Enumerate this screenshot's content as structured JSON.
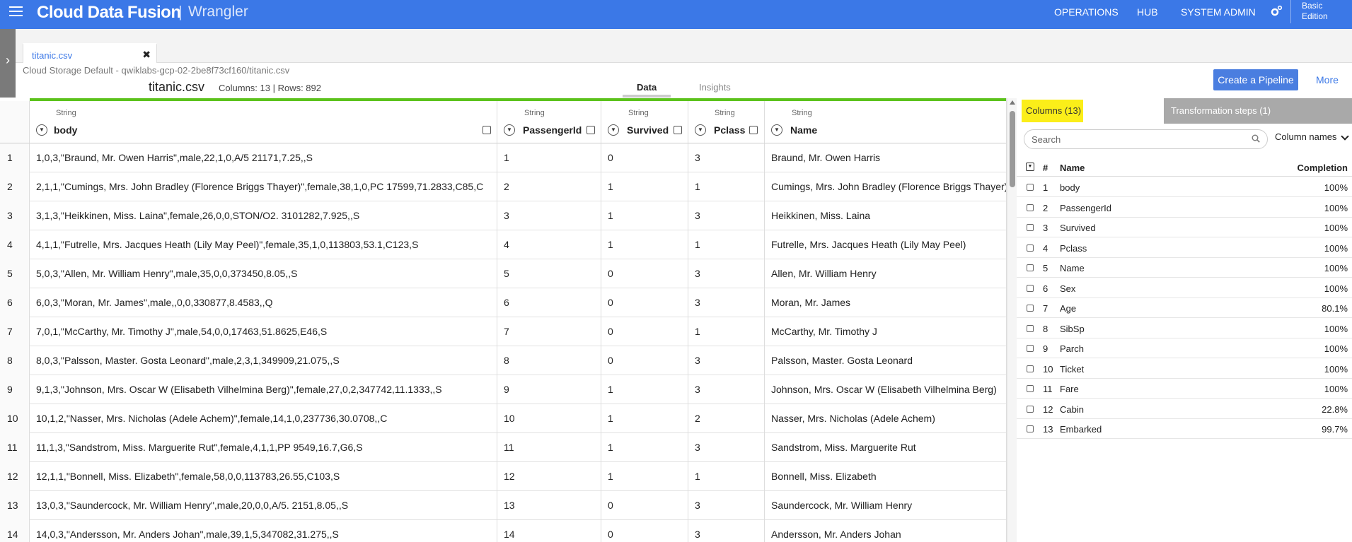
{
  "app": {
    "brand": "Cloud Data Fusion",
    "separator": "|",
    "product": "Wrangler",
    "nav": [
      "OPERATIONS",
      "HUB",
      "SYSTEM ADMIN"
    ],
    "edition_line1": "Basic",
    "edition_line2": "Edition"
  },
  "file_tab": {
    "label": "titanic.csv",
    "close": "✖"
  },
  "dataset": {
    "path": "Cloud Storage Default - qwiklabs-gcp-02-2be8f73cf160/titanic.csv",
    "name": "titanic.csv",
    "info": "Columns: 13 | Rows: 892",
    "tabs": [
      "Data",
      "Insights"
    ],
    "create_pipeline": "Create a Pipeline",
    "more": "More"
  },
  "grid": {
    "columns": [
      {
        "type": "String",
        "name": "body"
      },
      {
        "type": "String",
        "name": "PassengerId"
      },
      {
        "type": "String",
        "name": "Survived"
      },
      {
        "type": "String",
        "name": "Pclass"
      },
      {
        "type": "String",
        "name": "Name"
      }
    ],
    "rows": [
      [
        "1",
        "1,0,3,\"Braund, Mr. Owen Harris\",male,22,1,0,A/5 21171,7.25,,S",
        "1",
        "0",
        "3",
        "Braund, Mr. Owen Harris"
      ],
      [
        "2",
        "2,1,1,\"Cumings, Mrs. John Bradley (Florence Briggs Thayer)\",female,38,1,0,PC 17599,71.2833,C85,C",
        "2",
        "1",
        "1",
        "Cumings, Mrs. John Bradley (Florence Briggs Thayer)"
      ],
      [
        "3",
        "3,1,3,\"Heikkinen, Miss. Laina\",female,26,0,0,STON/O2. 3101282,7.925,,S",
        "3",
        "1",
        "3",
        "Heikkinen, Miss. Laina"
      ],
      [
        "4",
        "4,1,1,\"Futrelle, Mrs. Jacques Heath (Lily May Peel)\",female,35,1,0,113803,53.1,C123,S",
        "4",
        "1",
        "1",
        "Futrelle, Mrs. Jacques Heath (Lily May Peel)"
      ],
      [
        "5",
        "5,0,3,\"Allen, Mr. William Henry\",male,35,0,0,373450,8.05,,S",
        "5",
        "0",
        "3",
        "Allen, Mr. William Henry"
      ],
      [
        "6",
        "6,0,3,\"Moran, Mr. James\",male,,0,0,330877,8.4583,,Q",
        "6",
        "0",
        "3",
        "Moran, Mr. James"
      ],
      [
        "7",
        "7,0,1,\"McCarthy, Mr. Timothy J\",male,54,0,0,17463,51.8625,E46,S",
        "7",
        "0",
        "1",
        "McCarthy, Mr. Timothy J"
      ],
      [
        "8",
        "8,0,3,\"Palsson, Master. Gosta Leonard\",male,2,3,1,349909,21.075,,S",
        "8",
        "0",
        "3",
        "Palsson, Master. Gosta Leonard"
      ],
      [
        "9",
        "9,1,3,\"Johnson, Mrs. Oscar W (Elisabeth Vilhelmina Berg)\",female,27,0,2,347742,11.1333,,S",
        "9",
        "1",
        "3",
        "Johnson, Mrs. Oscar W (Elisabeth Vilhelmina Berg)"
      ],
      [
        "10",
        "10,1,2,\"Nasser, Mrs. Nicholas (Adele Achem)\",female,14,1,0,237736,30.0708,,C",
        "10",
        "1",
        "2",
        "Nasser, Mrs. Nicholas (Adele Achem)"
      ],
      [
        "11",
        "11,1,3,\"Sandstrom, Miss. Marguerite Rut\",female,4,1,1,PP 9549,16.7,G6,S",
        "11",
        "1",
        "3",
        "Sandstrom, Miss. Marguerite Rut"
      ],
      [
        "12",
        "12,1,1,\"Bonnell, Miss. Elizabeth\",female,58,0,0,113783,26.55,C103,S",
        "12",
        "1",
        "1",
        "Bonnell, Miss. Elizabeth"
      ],
      [
        "13",
        "13,0,3,\"Saundercock, Mr. William Henry\",male,20,0,0,A/5. 2151,8.05,,S",
        "13",
        "0",
        "3",
        "Saundercock, Mr. William Henry"
      ],
      [
        "14",
        "14,0,3,\"Andersson, Mr. Anders Johan\",male,39,1,5,347082,31.275,,S",
        "14",
        "0",
        "3",
        "Andersson, Mr. Anders Johan"
      ]
    ]
  },
  "side_panel": {
    "tab_columns": "Columns (13)",
    "tab_steps": "Transformation steps (1)",
    "search_placeholder": "Search",
    "sort_label": "Column names",
    "head": {
      "num": "#",
      "name": "Name",
      "completion": "Completion"
    },
    "columns": [
      {
        "num": "1",
        "name": "body",
        "completion": "100%"
      },
      {
        "num": "2",
        "name": "PassengerId",
        "completion": "100%"
      },
      {
        "num": "3",
        "name": "Survived",
        "completion": "100%"
      },
      {
        "num": "4",
        "name": "Pclass",
        "completion": "100%"
      },
      {
        "num": "5",
        "name": "Name",
        "completion": "100%"
      },
      {
        "num": "6",
        "name": "Sex",
        "completion": "100%"
      },
      {
        "num": "7",
        "name": "Age",
        "completion": "80.1%"
      },
      {
        "num": "8",
        "name": "SibSp",
        "completion": "100%"
      },
      {
        "num": "9",
        "name": "Parch",
        "completion": "100%"
      },
      {
        "num": "10",
        "name": "Ticket",
        "completion": "100%"
      },
      {
        "num": "11",
        "name": "Fare",
        "completion": "100%"
      },
      {
        "num": "12",
        "name": "Cabin",
        "completion": "22.8%"
      },
      {
        "num": "13",
        "name": "Embarked",
        "completion": "99.7%"
      }
    ]
  },
  "colors": {
    "topbar": "#3b78e7",
    "accent_green": "#5cc21c",
    "columns_tab": "#fbee19",
    "steps_tab": "#a9a9a9"
  }
}
